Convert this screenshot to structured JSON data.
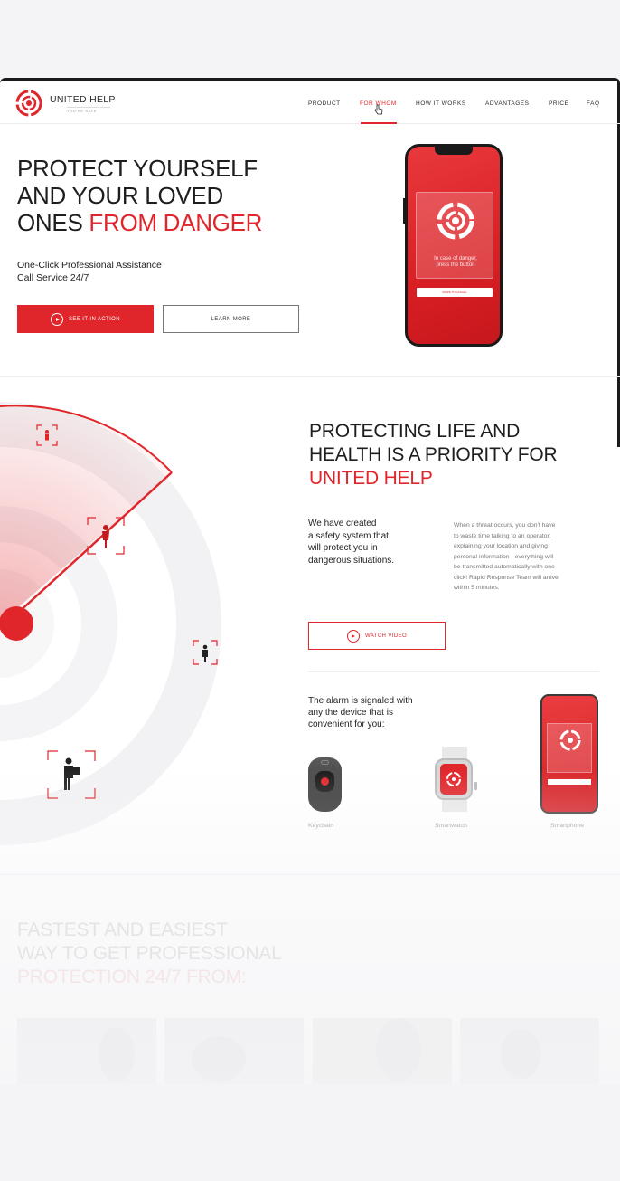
{
  "brand": {
    "name": "UNITED HELP",
    "tagline": "YOU'RE SAFE"
  },
  "nav": {
    "items": [
      {
        "label": "PRODUCT"
      },
      {
        "label": "FOR WHOM"
      },
      {
        "label": "HOW IT WORKS"
      },
      {
        "label": "ADVANTAGES"
      },
      {
        "label": "PRICE"
      },
      {
        "label": "FAQ"
      }
    ],
    "active": "FOR WHOM"
  },
  "hero": {
    "title_line1": "PROTECT YOURSELF",
    "title_line2": "AND YOUR LOVED",
    "title_line3_plain": "ONES ",
    "title_line3_red": "FROM DANGER",
    "subtitle_line1": "One-Click Professional Assistance",
    "subtitle_line2": "Call Service 24/7",
    "primary_button": "SEE IT IN ACTION",
    "secondary_button": "LEARN MORE",
    "phone_text_line1": "In case of danger,",
    "phone_text_line2": "press the button",
    "phone_bar": "SWIPE TO CANCEL"
  },
  "section2": {
    "title_line1": "PROTECTING LIFE AND",
    "title_line2": "HEALTH IS A PRIORITY FOR",
    "title_line3_red": "UNITED HELP",
    "lead_line1": "We have created",
    "lead_line2": "a safety system that",
    "lead_line3": "will protect you in",
    "lead_line4": "dangerous situations.",
    "body_line1": "When a threat occurs, you don't have",
    "body_line2": "to waste time talking to an operator,",
    "body_line3": "explaining your location and giving",
    "body_line4": "personal information - everything will",
    "body_line5": "be transmitted automatically with  one",
    "body_line6": "click! Rapid Response Team will arrive",
    "body_line7": "within 5 minutes.",
    "video_button": "WATCH VIDEO",
    "alarm_line1": "The alarm is signaled with",
    "alarm_line2": "any the device that is",
    "alarm_line3": "convenient for you:",
    "devices": [
      {
        "label": "Keychain"
      },
      {
        "label": "Smartwatch"
      },
      {
        "label": "Smartphone"
      }
    ]
  },
  "section3": {
    "title_line1": "FASTEST AND EASIEST",
    "title_line2": "WAY TO GET PROFESSIONAL",
    "title_line3_pink": "PROTECTION 24/7  FROM:"
  },
  "colors": {
    "accent": "#e0262b",
    "dark": "#1a1a1a",
    "muted": "#999999"
  }
}
